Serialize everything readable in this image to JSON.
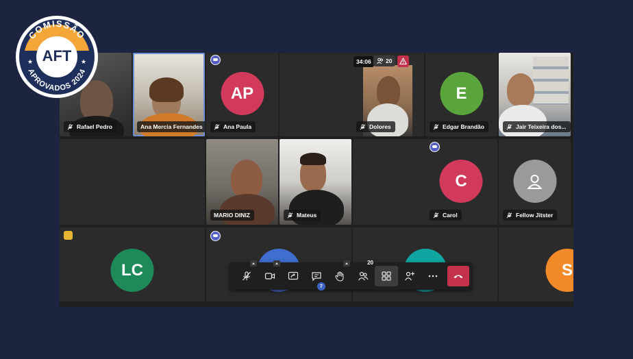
{
  "meeting": {
    "timer": "34:06",
    "participant_count": "20"
  },
  "tiles": [
    {
      "key": "rafael",
      "name": "Rafael Pedro"
    },
    {
      "key": "ana_mercia",
      "name": "Ana Mercia Fernandes"
    },
    {
      "key": "ana_paula",
      "name": "Ana Paula",
      "initials": "AP",
      "color": "#d13a5a"
    },
    {
      "key": "dolores",
      "name": "Dolores"
    },
    {
      "key": "edgar",
      "name": "Edgar Brandão",
      "initials": "E",
      "color": "#5aa53b"
    },
    {
      "key": "jair",
      "name": "Jair Teixeira dos..."
    },
    {
      "key": "mario",
      "name": "MARIO DINIZ"
    },
    {
      "key": "mateus",
      "name": "Mateus"
    },
    {
      "key": "carol",
      "name": "Carol",
      "initials": "C",
      "color": "#d13a5a"
    },
    {
      "key": "fellow",
      "name": "Fellow Jitster",
      "avatar_color": "#9a9a9a"
    },
    {
      "key": "lc",
      "initials": "LC",
      "color": "#1e8a5a"
    },
    {
      "key": "s",
      "initials": "S",
      "color": "#f28a2a"
    }
  ],
  "toolbar": {
    "chat_badge": "7",
    "people_count": "20",
    "end_color": "#c4314b",
    "icons": [
      "mic-off-icon",
      "camera-icon",
      "share-screen-icon",
      "chat-icon",
      "raise-hand-icon",
      "people-icon",
      "view-grid-icon",
      "add-people-icon",
      "more-icon",
      "end-call-icon"
    ]
  },
  "seal": {
    "top_text": "COMISSÃO",
    "center_text": "AFT",
    "bottom_text": "APROVADOS 2024"
  }
}
